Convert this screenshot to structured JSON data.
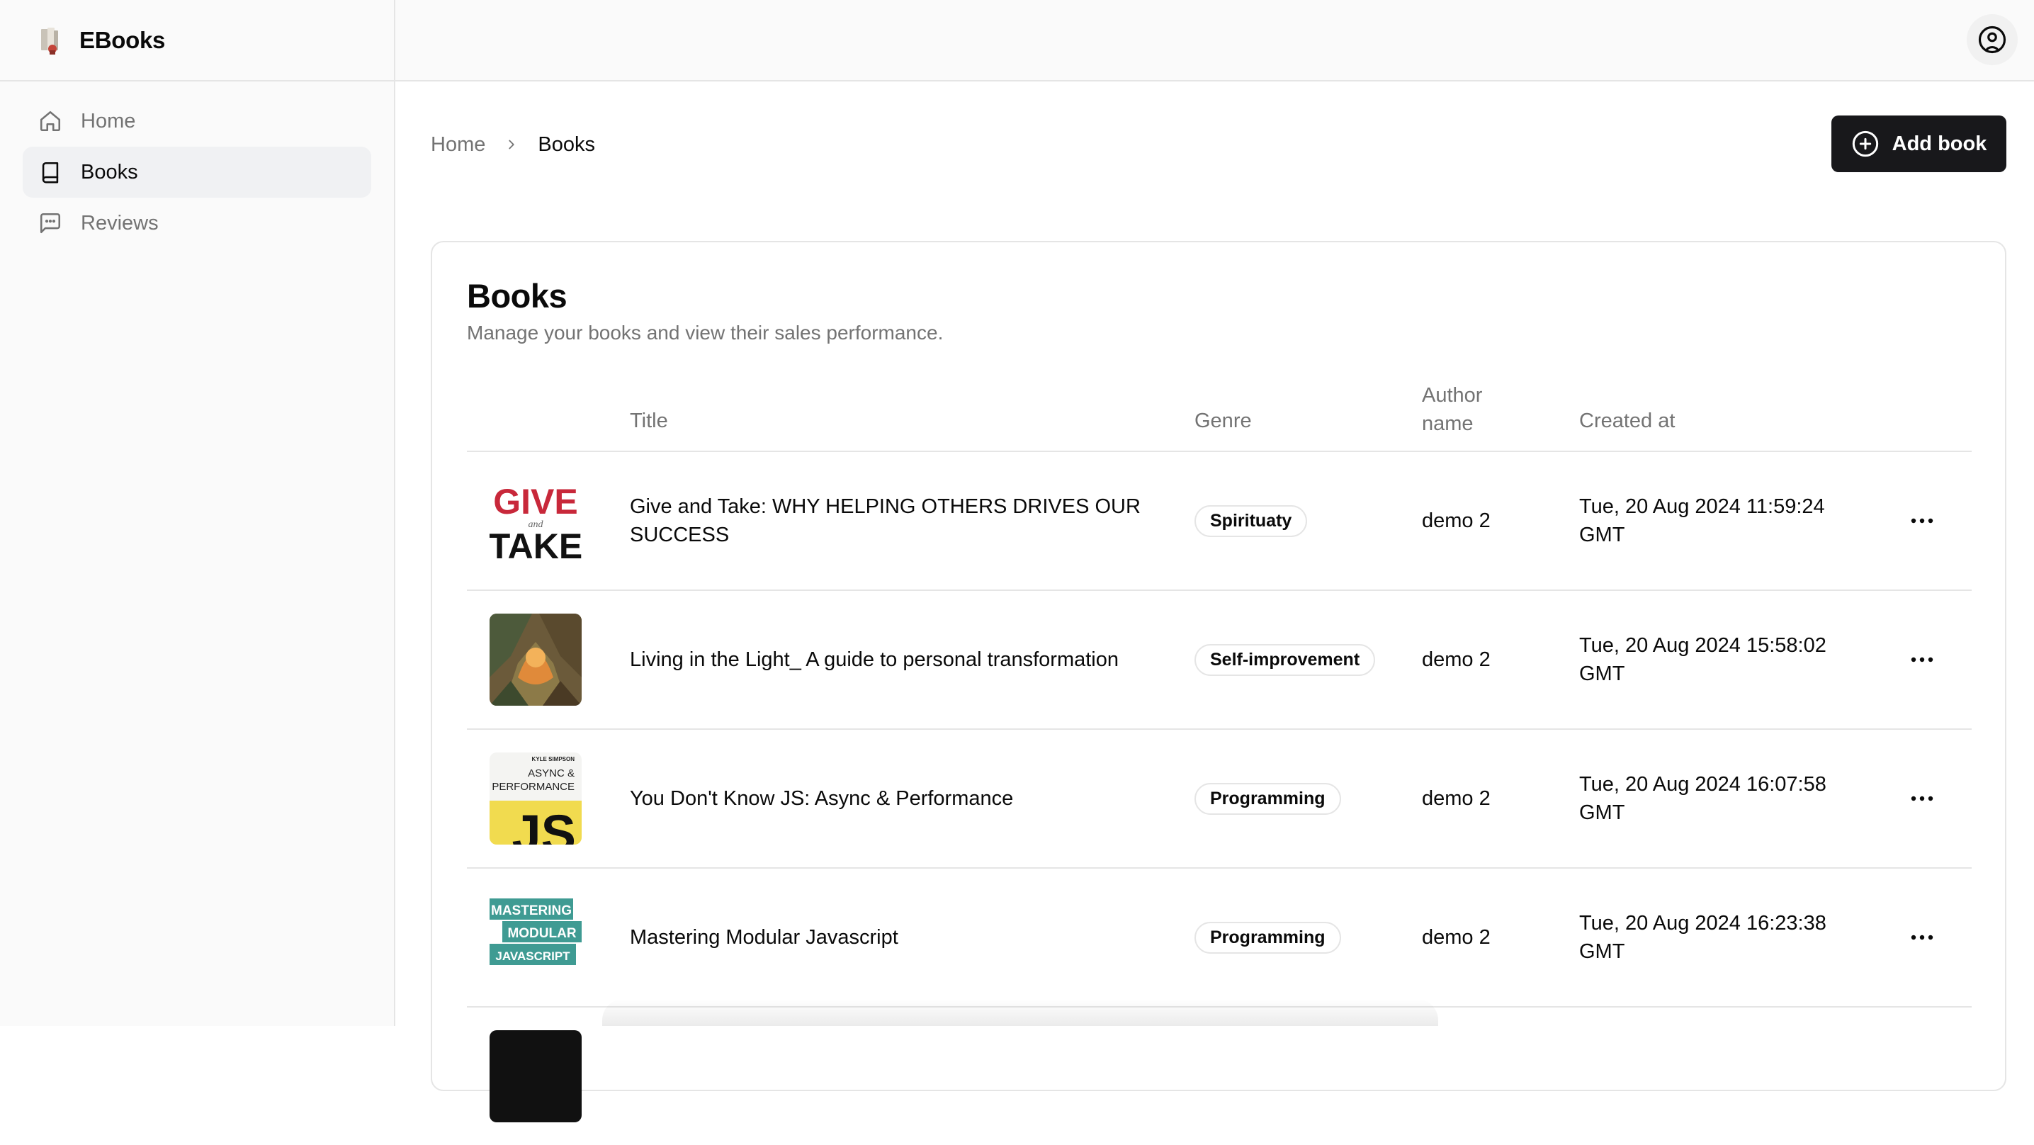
{
  "app": {
    "name": "EBooks"
  },
  "sidebar": {
    "items": [
      {
        "label": "Home",
        "icon": "home-icon",
        "active": false
      },
      {
        "label": "Books",
        "icon": "book-icon",
        "active": true
      },
      {
        "label": "Reviews",
        "icon": "message-square-icon",
        "active": false
      }
    ]
  },
  "topbar": {
    "account_icon": "user-circle-icon"
  },
  "breadcrumb": {
    "home": "Home",
    "current": "Books"
  },
  "actions": {
    "add_book": "Add book"
  },
  "card": {
    "title": "Books",
    "description": "Manage your books and view their sales performance."
  },
  "table": {
    "headers": {
      "title": "Title",
      "genre": "Genre",
      "author_line1": "Author",
      "author_line2": "name",
      "created": "Created at"
    },
    "rows": [
      {
        "cover": "give-and-take-cover",
        "title": "Give and Take: WHY HELPING OTHERS DRIVES OUR SUCCESS",
        "genre": "Spirituaty",
        "author": "demo 2",
        "created": "Tue, 20 Aug 2024 11:59:24 GMT"
      },
      {
        "cover": "living-in-the-light-cover",
        "title": "Living in the Light_ A guide to personal transformation",
        "genre": "Self-improvement",
        "author": "demo 2",
        "created": "Tue, 20 Aug 2024 15:58:02 GMT"
      },
      {
        "cover": "ydkjs-async-cover",
        "title": "You Don't Know JS: Async & Performance",
        "genre": "Programming",
        "author": "demo 2",
        "created": "Tue, 20 Aug 2024 16:07:58 GMT"
      },
      {
        "cover": "mastering-modular-js-cover",
        "title": "Mastering Modular Javascript",
        "genre": "Programming",
        "author": "demo 2",
        "created": "Tue, 20 Aug 2024 16:23:38 GMT"
      }
    ]
  },
  "covers": {
    "give_and_take": {
      "line1": "GIVE",
      "line2": "and",
      "line3": "TAKE"
    },
    "ydkjs": {
      "author": "KYLE SIMPSON",
      "line1": "ASYNC &",
      "line2": "PERFORMANCE",
      "big": "JS"
    },
    "mastering": {
      "line1": "MASTERING",
      "line2": "MODULAR",
      "line3": "JAVASCRIPT"
    }
  },
  "colors": {
    "primary_button": "#18181b",
    "border": "#e5e5e5",
    "muted_text": "#737373",
    "active_nav": "#f0f1f3"
  }
}
